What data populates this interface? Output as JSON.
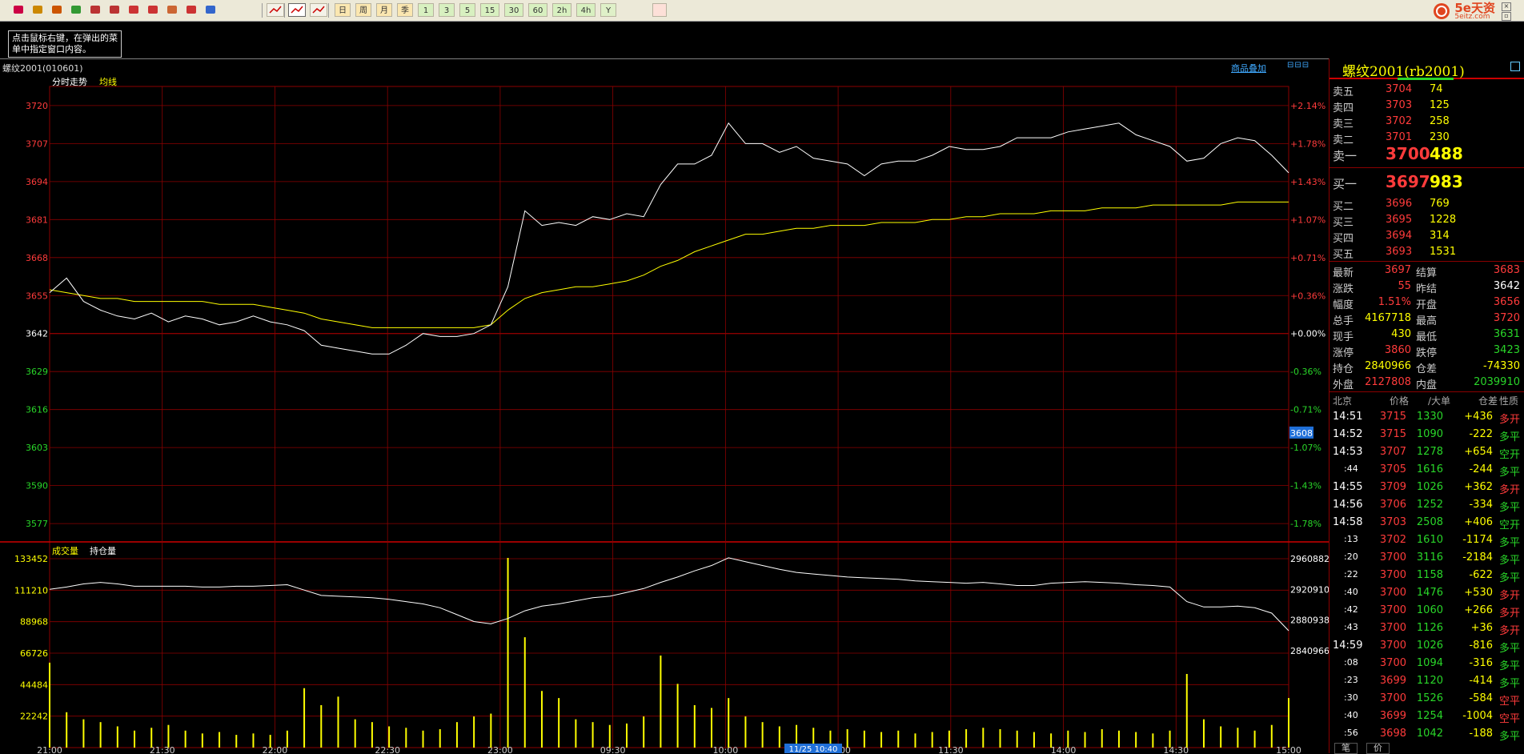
{
  "toolbar": {
    "buttons": [
      "日",
      "周",
      "月",
      "季",
      "1",
      "3",
      "5",
      "15",
      "30",
      "60",
      "2h",
      "4h",
      "Y"
    ]
  },
  "logo": {
    "text": "5e天资",
    "sub": "5eitz.com"
  },
  "hint": {
    "text": "点击鼠标右键，在弹出的菜单中指定窗口内容。"
  },
  "header": {
    "symbol": "螺纹2001(010601)",
    "overlay_link": "商品叠加"
  },
  "chart": {
    "price_title": "分时走势",
    "avg_title": "均线",
    "vol_title": "成交量",
    "oi_title": "持仓量",
    "cursor_price": "3608",
    "cursor_time": "11/25 10:40",
    "price_ticks": [
      "3720",
      "3707",
      "3694",
      "3681",
      "3668",
      "3655",
      "3642",
      "3629",
      "3616",
      "3603",
      "3590",
      "3577"
    ],
    "pct_ticks": [
      "+2.14%",
      "+1.78%",
      "+1.43%",
      "+1.07%",
      "+0.71%",
      "+0.36%",
      "+0.00%",
      "-0.36%",
      "-0.71%",
      "-1.07%",
      "-1.43%",
      "-1.78%"
    ],
    "vol_ticks": [
      "133452",
      "111210",
      "88968",
      "66726",
      "44484",
      "22242"
    ],
    "oi_ticks": [
      "2960882",
      "2920910",
      "2880938",
      "2840966"
    ],
    "time_labels": [
      "21:00",
      "21:30",
      "22:00",
      "22:30",
      "23:00",
      "09:30",
      "10:00",
      "11:00",
      "11:30",
      "14:00",
      "14:30",
      "15:00"
    ]
  },
  "chart_data": {
    "type": "line",
    "title": "",
    "prev_settle": 3642,
    "ylim": [
      3571,
      3726
    ],
    "series": [
      {
        "name": "分时走势",
        "values": [
          3656,
          3661,
          3653,
          3650,
          3648,
          3647,
          3649,
          3646,
          3648,
          3647,
          3645,
          3646,
          3648,
          3646,
          3645,
          3643,
          3638,
          3637,
          3636,
          3635,
          3635,
          3638,
          3642,
          3641,
          3641,
          3642,
          3645,
          3658,
          3684,
          3679,
          3680,
          3679,
          3682,
          3681,
          3683,
          3682,
          3693,
          3700,
          3700,
          3703,
          3714,
          3707,
          3707,
          3704,
          3706,
          3702,
          3701,
          3700,
          3696,
          3700,
          3701,
          3701,
          3703,
          3706,
          3705,
          3705,
          3706,
          3709,
          3709,
          3709,
          3711,
          3712,
          3713,
          3714,
          3710,
          3708,
          3706,
          3701,
          3702,
          3707,
          3709,
          3708,
          3703,
          3697
        ]
      },
      {
        "name": "均线",
        "values": [
          3657,
          3656,
          3655,
          3654,
          3654,
          3653,
          3653,
          3653,
          3653,
          3653,
          3652,
          3652,
          3652,
          3651,
          3650,
          3649,
          3647,
          3646,
          3645,
          3644,
          3644,
          3644,
          3644,
          3644,
          3644,
          3644,
          3645,
          3650,
          3654,
          3656,
          3657,
          3658,
          3658,
          3659,
          3660,
          3662,
          3665,
          3667,
          3670,
          3672,
          3674,
          3676,
          3676,
          3677,
          3678,
          3678,
          3679,
          3679,
          3679,
          3680,
          3680,
          3680,
          3681,
          3681,
          3682,
          3682,
          3683,
          3683,
          3683,
          3684,
          3684,
          3684,
          3685,
          3685,
          3685,
          3686,
          3686,
          3686,
          3686,
          3686,
          3687,
          3687,
          3687,
          3687
        ]
      },
      {
        "name": "成交量",
        "values": [
          60000,
          25000,
          20000,
          18000,
          15000,
          12000,
          14000,
          16000,
          12000,
          10000,
          11000,
          9000,
          10000,
          9000,
          12000,
          42000,
          30000,
          36000,
          20000,
          18000,
          15000,
          14000,
          12000,
          13000,
          18000,
          22000,
          24000,
          134000,
          78000,
          40000,
          35000,
          20000,
          18000,
          16000,
          17000,
          22000,
          65000,
          45000,
          30000,
          28000,
          35000,
          22000,
          18000,
          15000,
          16000,
          14000,
          12000,
          13000,
          12000,
          11000,
          12000,
          10000,
          11000,
          12000,
          13000,
          14000,
          13000,
          12000,
          11000,
          10000,
          12000,
          11000,
          13000,
          12000,
          11000,
          10000,
          12000,
          52000,
          20000,
          15000,
          14000,
          12000,
          16000,
          35000
        ]
      },
      {
        "name": "持仓量",
        "values": [
          2921000,
          2924000,
          2928000,
          2930000,
          2928000,
          2925000,
          2925000,
          2925000,
          2925000,
          2924000,
          2924000,
          2925000,
          2925000,
          2926000,
          2927000,
          2920000,
          2913000,
          2912000,
          2911000,
          2910000,
          2908000,
          2905000,
          2902000,
          2897000,
          2888000,
          2879000,
          2876000,
          2883000,
          2893000,
          2899000,
          2902000,
          2906000,
          2910000,
          2912000,
          2917000,
          2922000,
          2930000,
          2937000,
          2945000,
          2952000,
          2962000,
          2957000,
          2952000,
          2947000,
          2943000,
          2941000,
          2939000,
          2937000,
          2936000,
          2935000,
          2934000,
          2932000,
          2931000,
          2930000,
          2929000,
          2930000,
          2928000,
          2926000,
          2926000,
          2929000,
          2930000,
          2931000,
          2930000,
          2929000,
          2927000,
          2926000,
          2924000,
          2905000,
          2898000,
          2898000,
          2899000,
          2897000,
          2890000,
          2867000
        ]
      }
    ]
  },
  "panel": {
    "title": "螺纹2001(rb2001)",
    "asks": [
      {
        "label": "卖五",
        "price": "3704",
        "vol": "74"
      },
      {
        "label": "卖四",
        "price": "3703",
        "vol": "125"
      },
      {
        "label": "卖三",
        "price": "3702",
        "vol": "258"
      },
      {
        "label": "卖二",
        "price": "3701",
        "vol": "230"
      },
      {
        "label": "卖一",
        "price": "3700",
        "vol": "488"
      }
    ],
    "bids": [
      {
        "label": "买一",
        "price": "3697",
        "vol": "983"
      },
      {
        "label": "买二",
        "price": "3696",
        "vol": "769"
      },
      {
        "label": "买三",
        "price": "3695",
        "vol": "1228"
      },
      {
        "label": "买四",
        "price": "3694",
        "vol": "314"
      },
      {
        "label": "买五",
        "price": "3693",
        "vol": "1531"
      }
    ],
    "stats": [
      {
        "l1": "最新",
        "v1": "3697",
        "c1": "red",
        "l2": "结算",
        "v2": "3683",
        "c2": "red"
      },
      {
        "l1": "涨跌",
        "v1": "55",
        "c1": "red",
        "l2": "昨结",
        "v2": "3642",
        "c2": "wht"
      },
      {
        "l1": "幅度",
        "v1": "1.51%",
        "c1": "red",
        "l2": "开盘",
        "v2": "3656",
        "c2": "red"
      },
      {
        "l1": "总手",
        "v1": "4167718",
        "c1": "yel",
        "l2": "最高",
        "v2": "3720",
        "c2": "red"
      },
      {
        "l1": "现手",
        "v1": "430",
        "c1": "yel",
        "l2": "最低",
        "v2": "3631",
        "c2": "grn"
      },
      {
        "l1": "涨停",
        "v1": "3860",
        "c1": "red",
        "l2": "跌停",
        "v2": "3423",
        "c2": "grn"
      },
      {
        "l1": "持仓",
        "v1": "2840966",
        "c1": "yel",
        "l2": "仓差",
        "v2": "-74330",
        "c2": "yel"
      },
      {
        "l1": "外盘",
        "v1": "2127808",
        "c1": "red",
        "l2": "内盘",
        "v2": "2039910",
        "c2": "grn"
      }
    ],
    "tick_headers": [
      "北京",
      "价格",
      "∕大单",
      "仓差",
      "性质"
    ],
    "ticks": [
      {
        "t": "14:51",
        "p": "3715",
        "v": "1330",
        "d": "+436",
        "n": "多开",
        "nc": "red"
      },
      {
        "t": "14:52",
        "p": "3715",
        "v": "1090",
        "d": "-222",
        "n": "多平",
        "nc": "grn"
      },
      {
        "t": "14:53",
        "p": "3707",
        "v": "1278",
        "d": "+654",
        "n": "空开",
        "nc": "grn"
      },
      {
        "t": ":44",
        "p": "3705",
        "v": "1616",
        "d": "-244",
        "n": "多平",
        "nc": "grn"
      },
      {
        "t": "14:55",
        "p": "3709",
        "v": "1026",
        "d": "+362",
        "n": "多开",
        "nc": "red"
      },
      {
        "t": "14:56",
        "p": "3706",
        "v": "1252",
        "d": "-334",
        "n": "多平",
        "nc": "grn"
      },
      {
        "t": "14:58",
        "p": "3703",
        "v": "2508",
        "d": "+406",
        "n": "空开",
        "nc": "grn"
      },
      {
        "t": ":13",
        "p": "3702",
        "v": "1610",
        "d": "-1174",
        "n": "多平",
        "nc": "grn"
      },
      {
        "t": ":20",
        "p": "3700",
        "v": "3116",
        "d": "-2184",
        "n": "多平",
        "nc": "grn"
      },
      {
        "t": ":22",
        "p": "3700",
        "v": "1158",
        "d": "-622",
        "n": "多平",
        "nc": "grn"
      },
      {
        "t": ":40",
        "p": "3700",
        "v": "1476",
        "d": "+530",
        "n": "多开",
        "nc": "red"
      },
      {
        "t": ":42",
        "p": "3700",
        "v": "1060",
        "d": "+266",
        "n": "多开",
        "nc": "red"
      },
      {
        "t": ":43",
        "p": "3700",
        "v": "1126",
        "d": "+36",
        "n": "多开",
        "nc": "red"
      },
      {
        "t": "14:59",
        "p": "3700",
        "v": "1026",
        "d": "-816",
        "n": "多平",
        "nc": "grn"
      },
      {
        "t": ":08",
        "p": "3700",
        "v": "1094",
        "d": "-316",
        "n": "多平",
        "nc": "grn"
      },
      {
        "t": ":23",
        "p": "3699",
        "v": "1120",
        "d": "-414",
        "n": "多平",
        "nc": "grn"
      },
      {
        "t": ":30",
        "p": "3700",
        "v": "1526",
        "d": "-584",
        "n": "空平",
        "nc": "red"
      },
      {
        "t": ":40",
        "p": "3699",
        "v": "1254",
        "d": "-1004",
        "n": "空平",
        "nc": "red"
      },
      {
        "t": ":56",
        "p": "3698",
        "v": "1042",
        "d": "-188",
        "n": "多平",
        "nc": "grn"
      }
    ],
    "bottom_tabs": [
      "笔",
      "价"
    ]
  }
}
